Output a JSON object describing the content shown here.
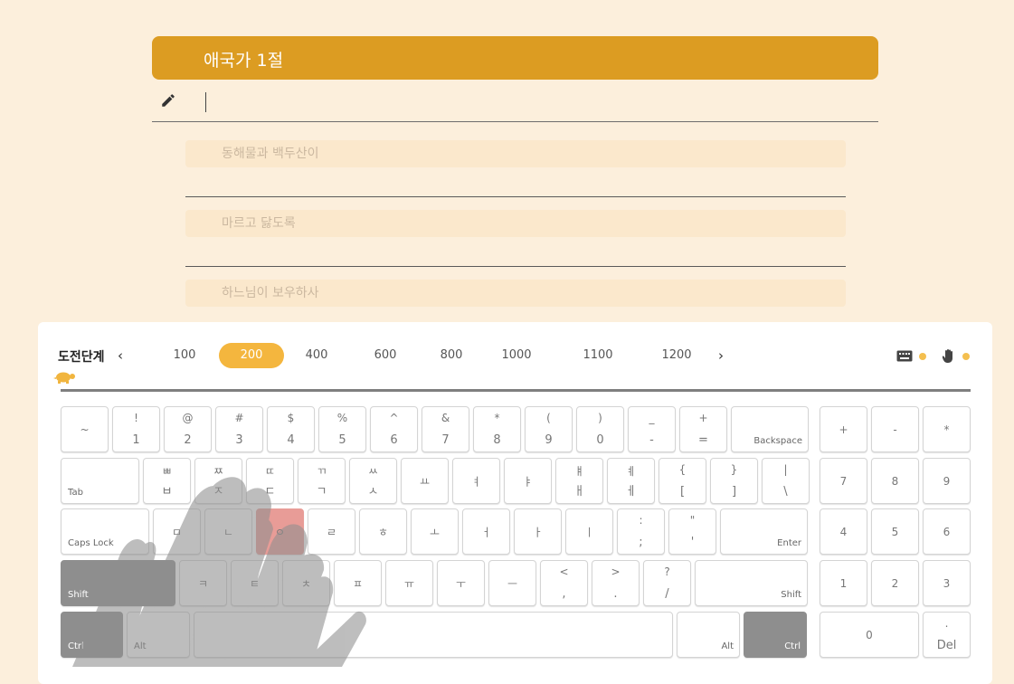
{
  "title": "애국가 1절",
  "input": {
    "value": ""
  },
  "lines": [
    {
      "text": "동해물과 백두산이"
    },
    {
      "text": "마르고 닳도록"
    },
    {
      "text": "하느님이 보우하사"
    }
  ],
  "levels": {
    "label": "도전단계",
    "items": [
      "100",
      "200",
      "400",
      "600",
      "800",
      "1000",
      "1100",
      "1200"
    ],
    "active": "200"
  },
  "keyboard": {
    "row1": [
      {
        "top": "~",
        "bot": ""
      },
      {
        "top": "!",
        "bot": "1"
      },
      {
        "top": "@",
        "bot": "2"
      },
      {
        "top": "#",
        "bot": "3"
      },
      {
        "top": "$",
        "bot": "4"
      },
      {
        "top": "%",
        "bot": "5"
      },
      {
        "top": "^",
        "bot": "6"
      },
      {
        "top": "&",
        "bot": "7"
      },
      {
        "top": "*",
        "bot": "8"
      },
      {
        "top": "(",
        "bot": "9"
      },
      {
        "top": ")",
        "bot": "0"
      },
      {
        "top": "_",
        "bot": "-"
      },
      {
        "top": "+",
        "bot": "="
      }
    ],
    "backspace": "Backspace",
    "tab": "Tab",
    "row2": [
      {
        "top": "ㅃ",
        "bot": "ㅂ"
      },
      {
        "top": "ㅉ",
        "bot": "ㅈ"
      },
      {
        "top": "ㄸ",
        "bot": "ㄷ"
      },
      {
        "top": "ㄲ",
        "bot": "ㄱ"
      },
      {
        "top": "ㅆ",
        "bot": "ㅅ"
      },
      {
        "top": "",
        "bot": "",
        "mid": "ㅛ"
      },
      {
        "top": "",
        "bot": "",
        "mid": "ㅕ"
      },
      {
        "top": "",
        "bot": "",
        "mid": "ㅑ"
      },
      {
        "top": "ㅒ",
        "bot": "ㅐ"
      },
      {
        "top": "ㅖ",
        "bot": "ㅔ"
      },
      {
        "top": "{",
        "bot": "["
      },
      {
        "top": "}",
        "bot": "]"
      },
      {
        "top": "|",
        "bot": "\\"
      }
    ],
    "capslock": "Caps Lock",
    "row3": [
      "ㅁ",
      "ㄴ",
      "ㅇ",
      "ㄹ",
      "ㅎ",
      "ㅗ",
      "ㅓ",
      "ㅏ",
      "ㅣ"
    ],
    "row3_sym": [
      {
        "top": ":",
        "bot": ";"
      },
      {
        "top": "\"",
        "bot": "'"
      }
    ],
    "enter": "Enter",
    "shift": "Shift",
    "row4": [
      "ㅋ",
      "ㅌ",
      "ㅊ",
      "ㅍ",
      "ㅠ",
      "ㅜ",
      "ㅡ"
    ],
    "row4_sym": [
      {
        "top": "<",
        "bot": ","
      },
      {
        "top": ">",
        "bot": "."
      },
      {
        "top": "?",
        "bot": "/"
      }
    ],
    "ctrl": "Ctrl",
    "alt": "Alt",
    "numpad": {
      "ops": [
        "+",
        "-",
        "*"
      ],
      "r1": [
        "7",
        "8",
        "9"
      ],
      "r2": [
        "4",
        "5",
        "6"
      ],
      "r3": [
        "1",
        "2",
        "3"
      ],
      "zero": "0",
      "dot": ".",
      "del": "Del"
    },
    "target_key": "ㅇ"
  },
  "colors": {
    "accent": "#dc9c22",
    "active_level": "#f4b63e",
    "target": "#e89c97",
    "background": "#fcefdc"
  },
  "icons": [
    "pencil-icon",
    "chevron-left-icon",
    "chevron-right-icon",
    "keyboard-icon",
    "hand-icon",
    "turtle-icon"
  ]
}
